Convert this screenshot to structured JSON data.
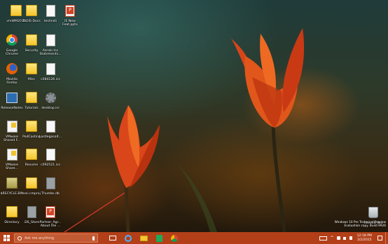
{
  "desktop": {
    "icons": [
      {
        "label": "vmWM2010",
        "type": "folder-icon"
      },
      {
        "label": "ToDIS-Docs",
        "type": "folder-icon"
      },
      {
        "label": "testinsti",
        "type": "document-icon"
      },
      {
        "label": "IE New\nFeat.pptx",
        "type": "powerpoint-icon"
      },
      {
        "label": "Google\nChrome",
        "type": "chrome-icon"
      },
      {
        "label": "Security",
        "type": "folder-icon"
      },
      {
        "label": "Azrolo Inc\nStatements...",
        "type": "document-icon"
      },
      {
        "label": "Mozilla\nFirefox",
        "type": "firefox-icon"
      },
      {
        "label": "Misc",
        "type": "folder-icon"
      },
      {
        "label": "c084126.ics",
        "type": "document-icon"
      },
      {
        "label": "ReleaseNotes",
        "type": "release-notes-icon"
      },
      {
        "label": "Tutorials",
        "type": "folder-icon"
      },
      {
        "label": "desktop.ini",
        "type": "settings-file-icon"
      },
      {
        "label": "VMware\nShared F...",
        "type": "vmware-icon"
      },
      {
        "label": "PodCasting",
        "type": "folder-icon"
      },
      {
        "label": "Lastlegasalt...",
        "type": "document-icon"
      },
      {
        "label": "VMware\nShare...",
        "type": "vmware-icon"
      },
      {
        "label": "Resume",
        "type": "folder-icon"
      },
      {
        "label": "c092521.ics",
        "type": "document-icon"
      },
      {
        "label": "$RECYCLE.BIN",
        "type": "folder-icon"
      },
      {
        "label": "sssi.cmproj",
        "type": "folder-icon"
      },
      {
        "label": "Thumbs.db",
        "type": "settings-file-icon"
      },
      {
        "label": "Directory",
        "type": "folder-icon"
      },
      {
        "label": ".DS_Store",
        "type": "document-icon"
      },
      {
        "label": "Partner_Agr...\nAbout the ...",
        "type": "powerpoint-icon"
      },
      {
        "label": "Recycle Bin",
        "type": "recycle-bin-icon"
      }
    ],
    "watermark": {
      "line1": "Windows 10 Pro Technical Preview",
      "line2": "Evaluation copy. Build 9926"
    }
  },
  "taskbar": {
    "search_placeholder": "Ask me anything",
    "time": "12:18 PM",
    "date": "2/2/2015",
    "colors": {
      "taskbar": "#b23f18",
      "search": "#c25a33"
    }
  }
}
